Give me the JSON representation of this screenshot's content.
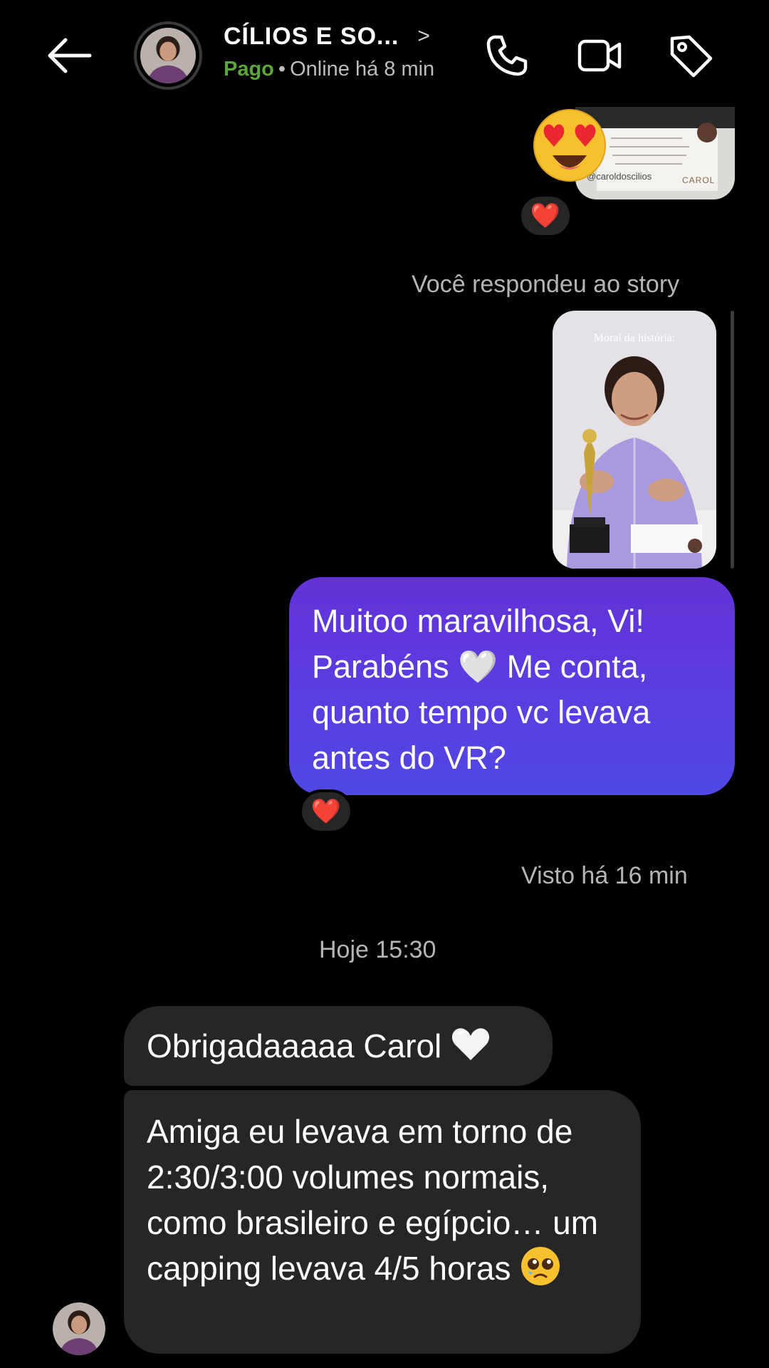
{
  "header": {
    "title": "CÍLIOS  E  SO...",
    "chevron": ">",
    "status_paid": "Pago",
    "status_separator": "•",
    "status_online": "Online há 8 min",
    "icons": [
      "back-arrow-icon",
      "phone-icon",
      "video-camera-icon",
      "tag-icon"
    ]
  },
  "messages": {
    "top_photo_caption": "@caroldoscilios",
    "top_photo_brand": "CAROL",
    "top_reaction": "❤️",
    "story_reply_label": "Você respondeu ao story",
    "story_overlay_text": "Moral da história:",
    "outgoing_text": "Muitoo maravilhosa, Vi! Parabéns 🤍 Me conta, quanto tempo vc levava antes do VR?",
    "outgoing_reaction": "❤️",
    "seen_label": "Visto há 16 min",
    "date_separator": "Hoje 15:30",
    "incoming_1": "Obrigadaaaaa Carol",
    "incoming_2": "Amiga eu levava em torno de 2:30/3:00 volumes normais, como brasileiro e egípcio… um capping levava 4/5 horas"
  },
  "colors": {
    "background": "#000000",
    "bubble_in": "#262626",
    "bubble_out_top": "#6232d8",
    "bubble_out_bottom": "#4f48e2",
    "paid_green": "#5aa83c"
  }
}
